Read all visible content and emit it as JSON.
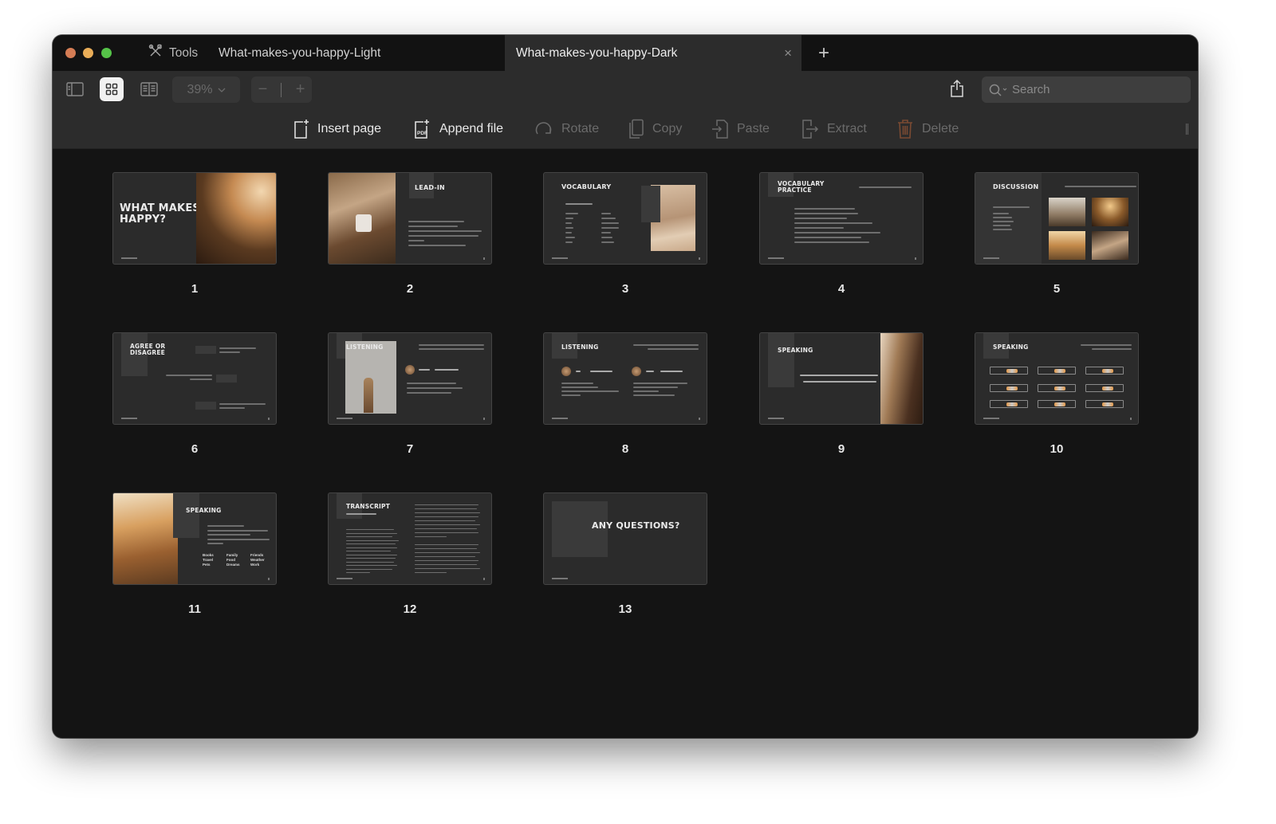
{
  "window": {
    "tabs": [
      {
        "label": "Tools",
        "icon": "tools-icon"
      },
      {
        "label": "What-makes-you-happy-Light",
        "active": false
      },
      {
        "label": "What-makes-you-happy-Dark",
        "active": true
      }
    ],
    "new_tab_label": "+",
    "close_tab_label": "×"
  },
  "toolbar": {
    "zoom_level": "39%",
    "zoom_out_label": "−",
    "zoom_in_label": "+",
    "search_placeholder": "Search"
  },
  "actions": [
    {
      "label": "Insert page",
      "icon": "insert-page-icon",
      "enabled": true
    },
    {
      "label": "Append file",
      "icon": "append-pdf-icon",
      "enabled": true
    },
    {
      "label": "Rotate",
      "icon": "rotate-icon",
      "enabled": false
    },
    {
      "label": "Copy",
      "icon": "copy-icon",
      "enabled": false
    },
    {
      "label": "Paste",
      "icon": "paste-icon",
      "enabled": false
    },
    {
      "label": "Extract",
      "icon": "extract-icon",
      "enabled": false
    },
    {
      "label": "Delete",
      "icon": "trash-icon",
      "enabled": false
    }
  ],
  "colors": {
    "delete_icon": "#7a4a32",
    "window_bg": "#141414",
    "toolbar_bg": "#2c2c2c",
    "slide_bg": "#2b2b2b"
  },
  "pages": [
    {
      "number": "1",
      "title": "WHAT MAKES YOU HAPPY?"
    },
    {
      "number": "2",
      "title": "LEAD-IN"
    },
    {
      "number": "3",
      "title": "VOCABULARY",
      "subtitle": "Connect the phrases"
    },
    {
      "number": "4",
      "title": "VOCABULARY PRACTICE",
      "subtitle": "Fill in the blanks with the missing words"
    },
    {
      "number": "5",
      "title": "DISCUSSION",
      "subtitle": "Describe the pictures. What do you believe makes these people happy?"
    },
    {
      "number": "6",
      "title": "AGREE OR DISAGREE"
    },
    {
      "number": "7",
      "title": "LISTENING",
      "speaker": "Alicia",
      "play": "Click to play"
    },
    {
      "number": "8",
      "title": "LISTENING",
      "speakers": [
        "Ed",
        "Ryan"
      ],
      "play": "Click to play"
    },
    {
      "number": "9",
      "title": "SPEAKING",
      "question": "What do you usually do to lift your mood when you're feeling down or stressed?"
    },
    {
      "number": "10",
      "title": "SPEAKING",
      "subtitle": "Discuss ways to lift your mood using the emojis provided below"
    },
    {
      "number": "11",
      "title": "SPEAKING",
      "topics": [
        "Books",
        "Family",
        "Friends",
        "Travel",
        "Food",
        "Weather",
        "Pets",
        "Dreams",
        "Work"
      ]
    },
    {
      "number": "12",
      "title": "TRANSCRIPT",
      "subtitle": "Listening section p. 7-8"
    },
    {
      "number": "13",
      "title": "ANY QUESTIONS?"
    }
  ]
}
